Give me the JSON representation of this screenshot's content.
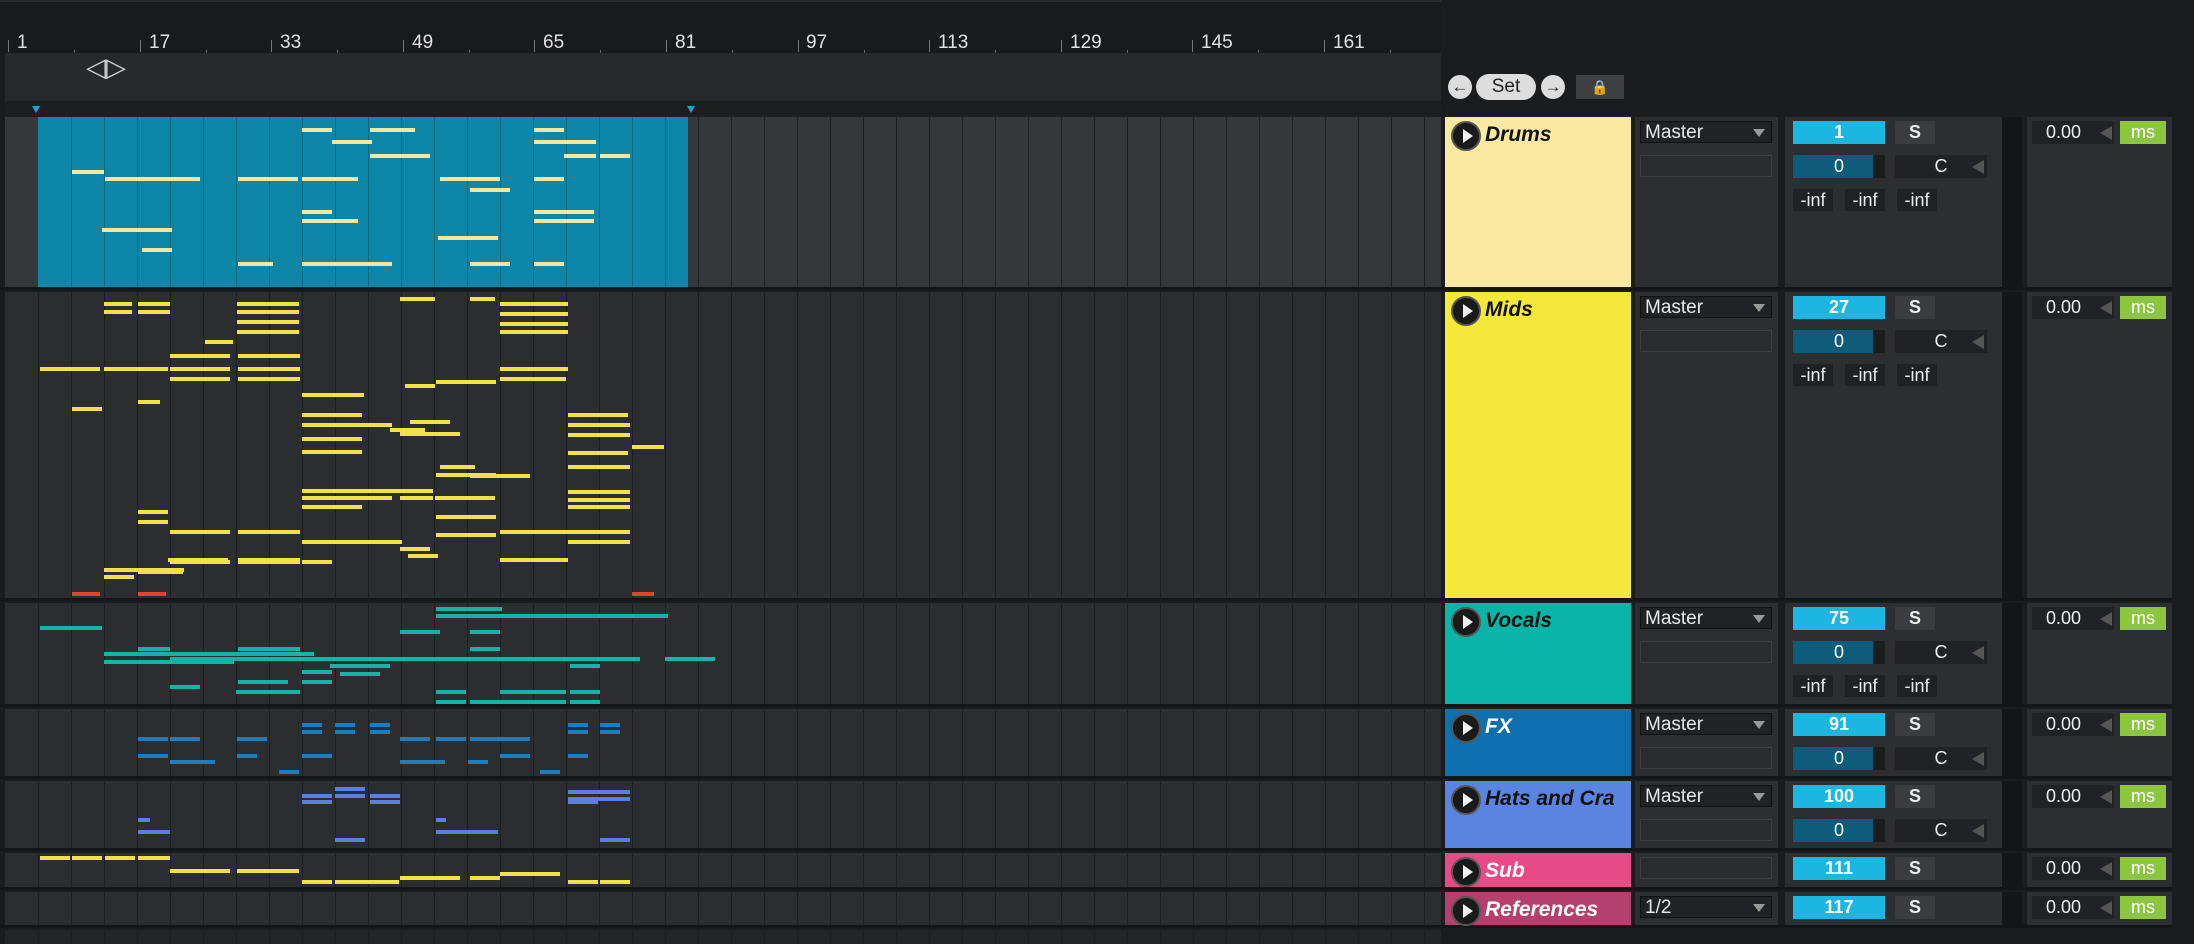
{
  "ruler": {
    "bars": [
      "1",
      "17",
      "33",
      "49",
      "65",
      "81",
      "97",
      "113",
      "129",
      "145",
      "161"
    ]
  },
  "loop_icon": "loop-brace-icon",
  "transport": {
    "prev_icon": "arrow-left-icon",
    "set_label": "Set",
    "next_icon": "arrow-right-icon",
    "lock_icon": "lock-icon"
  },
  "tracks": [
    {
      "name": "Drums",
      "color": "#fbe9a1",
      "output": "Master",
      "volume": "1",
      "solo": "S",
      "pan": "0",
      "pan_center": "C",
      "meters": [
        "-inf",
        "-inf",
        "-inf"
      ],
      "delay": "0.00",
      "delay_unit": "ms"
    },
    {
      "name": "Mids",
      "color": "#f4e83b",
      "output": "Master",
      "volume": "27",
      "solo": "S",
      "pan": "0",
      "pan_center": "C",
      "meters": [
        "-inf",
        "-inf",
        "-inf"
      ],
      "delay": "0.00",
      "delay_unit": "ms"
    },
    {
      "name": "Vocals",
      "color": "#0ab5a7",
      "output": "Master",
      "volume": "75",
      "solo": "S",
      "pan": "0",
      "pan_center": "C",
      "meters": [
        "-inf",
        "-inf",
        "-inf"
      ],
      "delay": "0.00",
      "delay_unit": "ms"
    },
    {
      "name": "FX",
      "color": "#0f70b0",
      "output": "Master",
      "volume": "91",
      "solo": "S",
      "pan": "0",
      "pan_center": "C",
      "delay": "0.00",
      "delay_unit": "ms"
    },
    {
      "name": "Hats and Cra",
      "color": "#5b84e0",
      "output": "Master",
      "volume": "100",
      "solo": "S",
      "pan": "0",
      "pan_center": "C",
      "delay": "0.00",
      "delay_unit": "ms"
    },
    {
      "name": "Sub",
      "color": "#e84a86",
      "output": "",
      "volume": "111",
      "solo": "S",
      "delay": "0.00",
      "delay_unit": "ms"
    },
    {
      "name": "References",
      "color": "#b5406d",
      "output": "1/2",
      "volume": "117",
      "solo": "S",
      "delay": "0.00",
      "delay_unit": "ms"
    }
  ],
  "colors": {
    "clip_drums": "#f5e6a0",
    "clip_mids": "#f1e046",
    "clip_vocals": "#15b3a6",
    "clip_fx": "#1a7fc1",
    "clip_hats": "#5b7fe0",
    "clip_sub": "#f1e046",
    "loop_region": "#0d86a8",
    "volume": "#1db6e0",
    "delay_unit": "#8cc63f",
    "red_marker": "#e0442c"
  }
}
